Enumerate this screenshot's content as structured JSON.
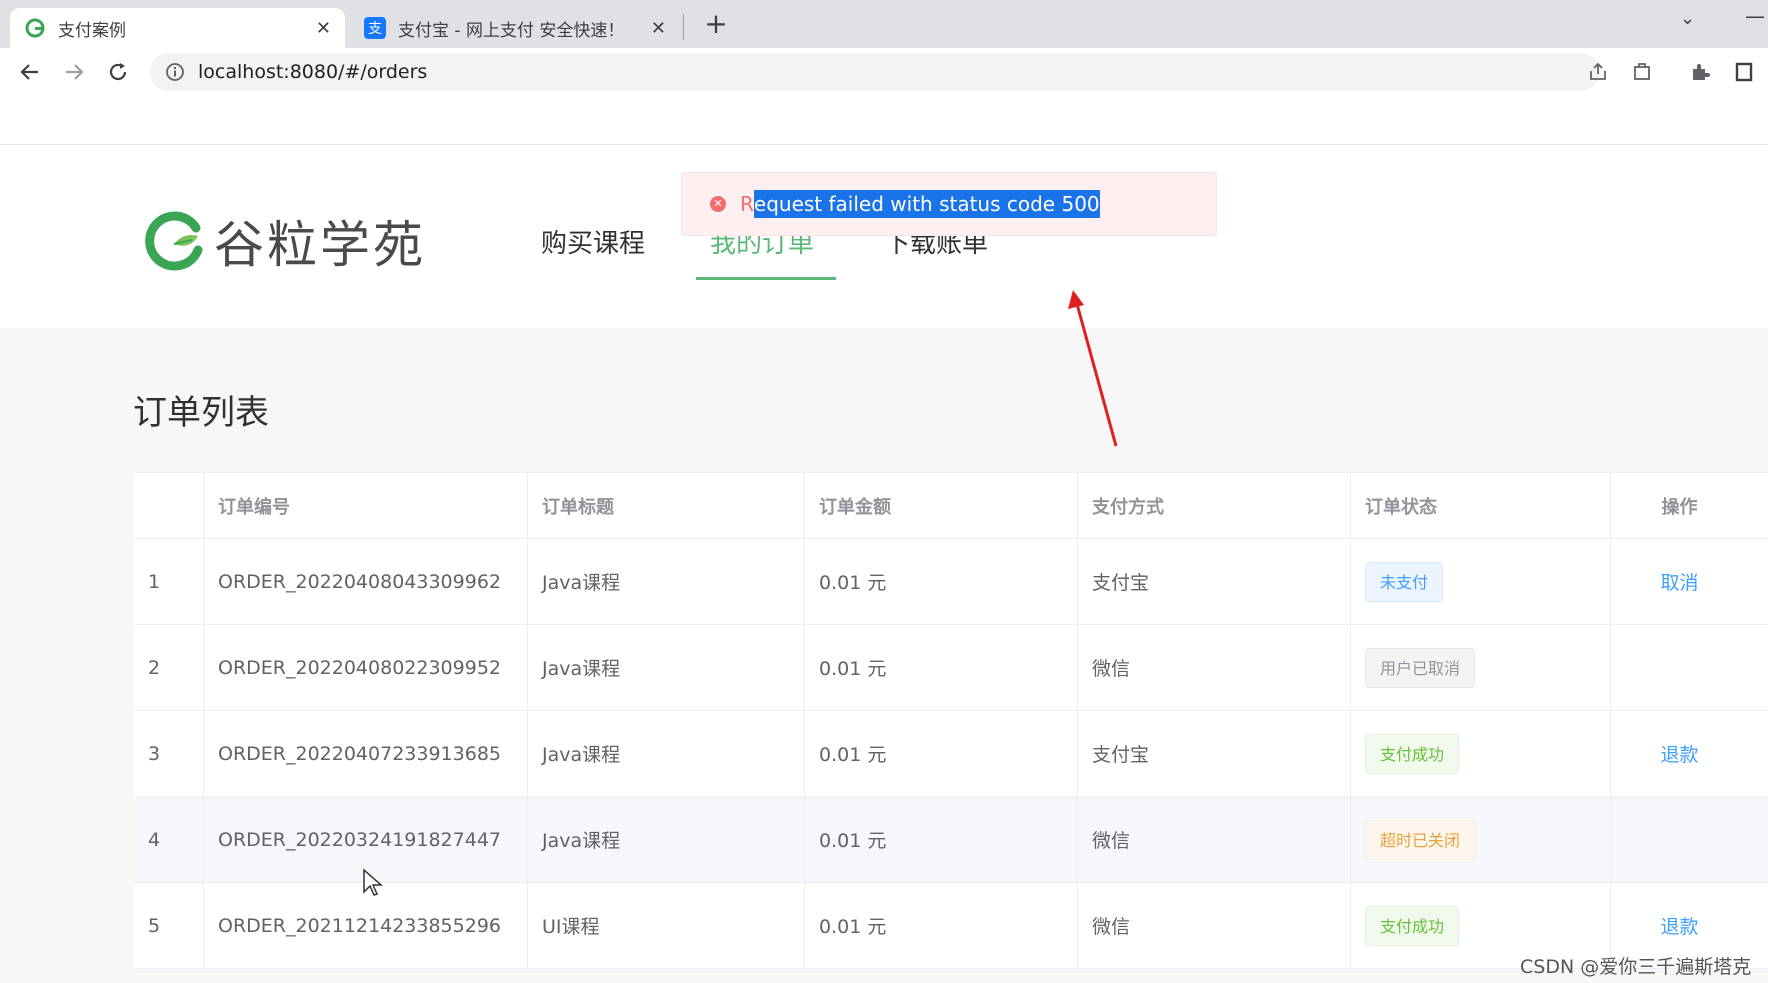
{
  "browser": {
    "tabs": [
      {
        "title": "支付案例",
        "active": true
      },
      {
        "title": "支付宝 - 网上支付 安全快速！",
        "active": false
      }
    ],
    "url": "localhost:8080/#/orders"
  },
  "header": {
    "logo_text": "谷粒学苑",
    "nav": [
      {
        "label": "购买课程",
        "active": false
      },
      {
        "label": "我的订单",
        "active": true
      },
      {
        "label": "下载账单",
        "active": false
      }
    ]
  },
  "message": {
    "type": "error",
    "first_char": "R",
    "rest": "equest failed with status code 500"
  },
  "page": {
    "title": "订单列表"
  },
  "table": {
    "columns": [
      "",
      "订单编号",
      "订单标题",
      "订单金额",
      "支付方式",
      "订单状态",
      "操作"
    ],
    "rows": [
      {
        "index": "1",
        "order_no": "ORDER_20220408043309962",
        "title": "Java课程",
        "amount": "0.01 元",
        "pay_type": "支付宝",
        "status": "未支付",
        "status_color": "blue",
        "action": "取消"
      },
      {
        "index": "2",
        "order_no": "ORDER_20220408022309952",
        "title": "Java课程",
        "amount": "0.01 元",
        "pay_type": "微信",
        "status": "用户已取消",
        "status_color": "gray",
        "action": ""
      },
      {
        "index": "3",
        "order_no": "ORDER_20220407233913685",
        "title": "Java课程",
        "amount": "0.01 元",
        "pay_type": "支付宝",
        "status": "支付成功",
        "status_color": "green",
        "action": "退款"
      },
      {
        "index": "4",
        "order_no": "ORDER_20220324191827447",
        "title": "Java课程",
        "amount": "0.01 元",
        "pay_type": "微信",
        "status": "超时已关闭",
        "status_color": "orange",
        "action": ""
      },
      {
        "index": "5",
        "order_no": "ORDER_20211214233855296",
        "title": "UI课程",
        "amount": "0.01 元",
        "pay_type": "微信",
        "status": "支付成功",
        "status_color": "green",
        "action": "退款"
      }
    ]
  },
  "watermark": "CSDN @爱你三千遍斯塔克",
  "colors": {
    "accent": "#5cb87a",
    "error": "#f56c6c",
    "link": "#409eff",
    "annotation_arrow": "#e0201c"
  }
}
